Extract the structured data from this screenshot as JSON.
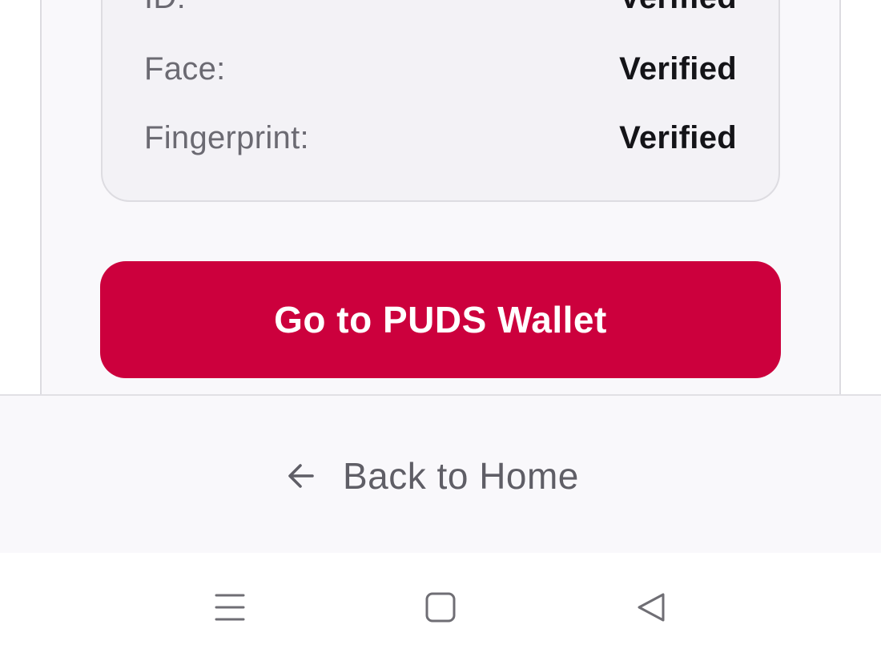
{
  "verification": {
    "rows": [
      {
        "label": "ID:",
        "value": "Verified"
      },
      {
        "label": "Face:",
        "value": "Verified"
      },
      {
        "label": "Fingerprint:",
        "value": "Verified"
      }
    ]
  },
  "actions": {
    "wallet_button_label": "Go to PUDS Wallet",
    "back_label": "Back to Home"
  },
  "icons": {
    "back": "arrow-left-icon",
    "nav_menu": "menu-icon",
    "nav_home": "home-square-icon",
    "nav_back": "back-triangle-icon"
  },
  "colors": {
    "primary": "#cc003d",
    "panel_bg": "#f3f2f6",
    "label_text": "#6b6a72",
    "value_text": "#141418"
  }
}
